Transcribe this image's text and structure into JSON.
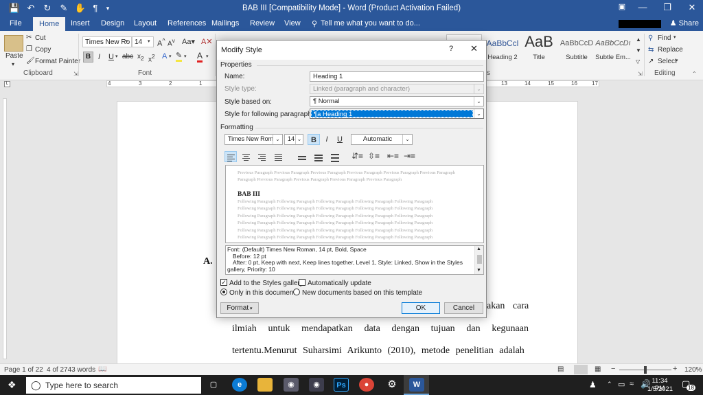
{
  "titlebar": {
    "document_title": "BAB III [Compatibility Mode] - Word (Product Activation Failed)",
    "share": "Share"
  },
  "tabs": [
    {
      "label": "File"
    },
    {
      "label": "Home"
    },
    {
      "label": "Insert"
    },
    {
      "label": "Design"
    },
    {
      "label": "Layout"
    },
    {
      "label": "References"
    },
    {
      "label": "Mailings"
    },
    {
      "label": "Review"
    },
    {
      "label": "View"
    }
  ],
  "tell_me": "Tell me what you want to do...",
  "ribbon": {
    "paste": "Paste",
    "cut": "Cut",
    "copy": "Copy",
    "format_painter": "Format Painter",
    "clipboard_label": "Clipboard",
    "font_name": "Times New Ro",
    "font_size": "14",
    "font_label": "Font",
    "styles": [
      {
        "preview": "AaBbCcl",
        "name": "Heading 2"
      },
      {
        "preview": "AaB",
        "name": "Title"
      },
      {
        "preview": "AaBbCcD",
        "name": "Subtitle"
      },
      {
        "preview": "AaBbCcDı",
        "name": "Subtle Em..."
      }
    ],
    "styles_label_fragment": "s",
    "find": "Find",
    "replace": "Replace",
    "select": "Select",
    "editing_label": "Editing"
  },
  "ruler": {
    "left_ticks": [
      "4",
      "3",
      "2",
      "1"
    ],
    "right_ticks": [
      "13",
      "14",
      "15",
      "16",
      "17"
    ]
  },
  "document": {
    "section_letter": "A.",
    "line1_end": "akan   cara",
    "line2": [
      "ilmiah",
      "untuk",
      "mendapatkan",
      "data",
      "dengan",
      "tujuan",
      "dan",
      "kegunaan"
    ],
    "line3": "tertentu.Menurut Suharsimi Arikunto (2010), metode penelitian adalah"
  },
  "dialog": {
    "title": "Modify Style",
    "help": "?",
    "properties_label": "Properties",
    "name_label": "Name:",
    "name_value": "Heading 1",
    "style_type_label": "Style type:",
    "style_type_value": "Linked (paragraph and character)",
    "based_on_label": "Style based on:",
    "based_on_value": "Normal",
    "following_label": "Style for following paragraph:",
    "following_value": "Heading 1",
    "formatting_label": "Formatting",
    "font_name": "Times New Roman",
    "font_size": "14",
    "bold": "B",
    "italic": "I",
    "underline": "U",
    "color": "Automatic",
    "preview": {
      "previous": "Previous Paragraph Previous Paragraph Previous Paragraph Previous Paragraph Previous Paragraph Previous Paragraph",
      "previous2": "Paragraph Previous Paragraph Previous Paragraph Previous Paragraph Previous Paragraph",
      "heading": "BAB III",
      "following": "Following Paragraph Following Paragraph Following Paragraph Following Paragraph Following Paragraph"
    },
    "description": {
      "line1": "Font: (Default) Times New Roman, 14 pt, Bold, Space",
      "line2": "Before:  12 pt",
      "line3": "After:  0 pt, Keep with next, Keep lines together, Level 1, Style: Linked, Show in the Styles",
      "line4": "gallery, Priority: 10"
    },
    "add_to_gallery": "Add to the Styles gallery",
    "auto_update": "Automatically update",
    "only_this_doc": "Only in this document",
    "new_docs": "New documents based on this template",
    "format_button": "Format",
    "ok": "OK",
    "cancel": "Cancel"
  },
  "statusbar": {
    "page": "Page 1 of 22",
    "words": "4 of 2743 words",
    "zoom": "120%"
  },
  "taskbar": {
    "search_placeholder": "Type here to search",
    "time": "11:34 PM",
    "date": "1/5/2021",
    "notification_count": "18"
  },
  "colors": {
    "word_blue": "#2b579a",
    "selection": "#0078d7",
    "taskbar": "#1f1f1f"
  }
}
